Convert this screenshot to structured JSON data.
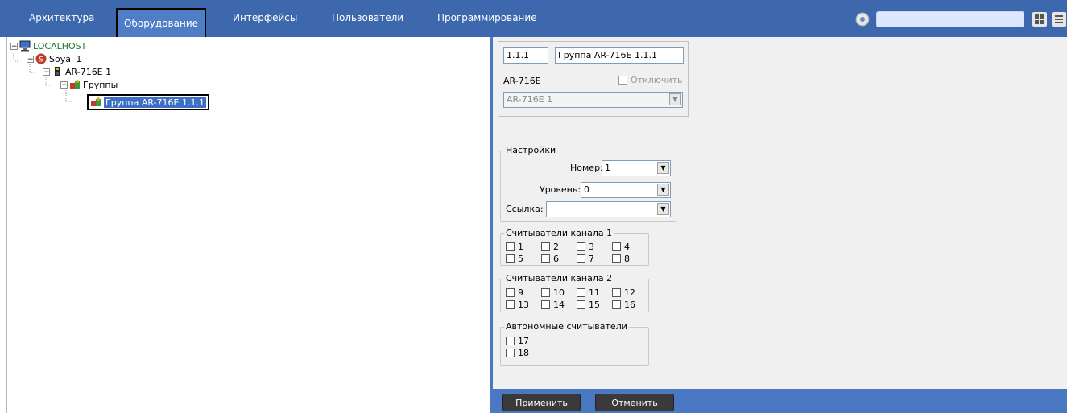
{
  "nav": {
    "tabs": [
      "Архитектура",
      "Оборудование",
      "Интерфейсы",
      "Пользователи",
      "Программирование"
    ],
    "active_tab": "Оборудование",
    "search_value": ""
  },
  "tree": {
    "root": "LOCALHOST",
    "controller": "Soyal 1",
    "device": "AR-716E 1",
    "groups_folder": "Группы",
    "selected_group": "Группа AR-716E  1.1.1"
  },
  "header": {
    "id_value": "1.1.1",
    "name_value": "Группа AR-716E  1.1.1",
    "device_type": "AR-716E",
    "disable_label": "Отключить",
    "parent_value": "AR-716E 1"
  },
  "settings": {
    "title": "Настройки",
    "number_label": "Номер:",
    "number_value": "1",
    "level_label": "Уровень:",
    "level_value": "0",
    "link_label": "Ссылка:",
    "link_value": ""
  },
  "channel1": {
    "title": "Считыватели канала 1",
    "readers": [
      "1",
      "2",
      "3",
      "4",
      "5",
      "6",
      "7",
      "8"
    ]
  },
  "channel2": {
    "title": "Считыватели канала 2",
    "readers": [
      "9",
      "10",
      "11",
      "12",
      "13",
      "14",
      "15",
      "16"
    ]
  },
  "autonomous": {
    "title": "Автономные считыватели",
    "readers": [
      "17",
      "18"
    ]
  },
  "buttons": {
    "apply": "Применить",
    "cancel": "Отменить"
  },
  "colors": {
    "topbar": "#3d68ad",
    "panel": "#4b78c2",
    "form": "#f0f0f0"
  }
}
